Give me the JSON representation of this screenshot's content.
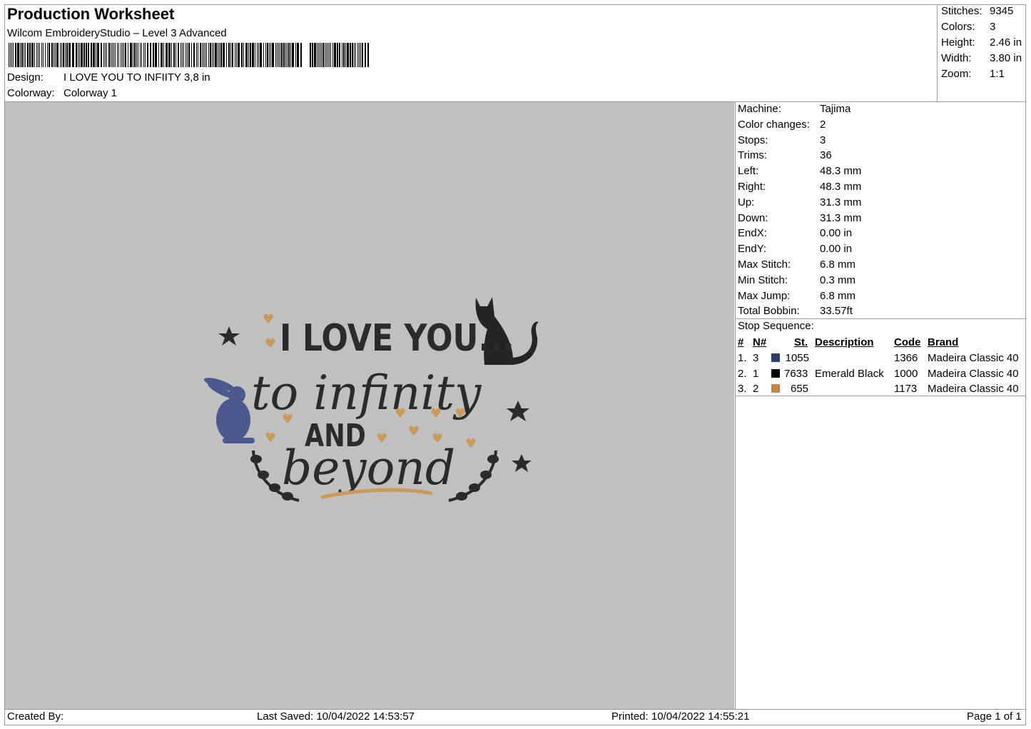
{
  "header": {
    "title": "Production Worksheet",
    "software": "Wilcom EmbroideryStudio – Level 3 Advanced",
    "design_label": "Design:",
    "design_value": "I LOVE YOU TO INFIITY 3,8 in",
    "colorway_label": "Colorway:",
    "colorway_value": "Colorway 1"
  },
  "summary": [
    {
      "label": "Stitches:",
      "value": "9345"
    },
    {
      "label": "Colors:",
      "value": "3"
    },
    {
      "label": "Height:",
      "value": "2.46 in"
    },
    {
      "label": "Width:",
      "value": "3.80 in"
    },
    {
      "label": "Zoom:",
      "value": "1:1"
    }
  ],
  "machine_info": [
    {
      "label": "Machine:",
      "value": "Tajima"
    },
    {
      "label": "Color changes:",
      "value": "2"
    },
    {
      "label": "Stops:",
      "value": "3"
    },
    {
      "label": "Trims:",
      "value": "36"
    },
    {
      "label": "Left:",
      "value": "48.3 mm"
    },
    {
      "label": "Right:",
      "value": "48.3 mm"
    },
    {
      "label": "Up:",
      "value": "31.3 mm"
    },
    {
      "label": "Down:",
      "value": "31.3 mm"
    },
    {
      "label": "EndX:",
      "value": "0.00 in"
    },
    {
      "label": "EndY:",
      "value": "0.00 in"
    },
    {
      "label": "Max Stitch:",
      "value": "6.8 mm"
    },
    {
      "label": "Min Stitch:",
      "value": "0.3 mm"
    },
    {
      "label": "Max Jump:",
      "value": "6.8 mm"
    },
    {
      "label": "Total Bobbin:",
      "value": "33.57ft"
    }
  ],
  "stop_sequence": {
    "title": "Stop Sequence:",
    "headers": {
      "num": "#",
      "needle": "N#",
      "st": "St.",
      "description": "Description",
      "code": "Code",
      "brand": "Brand"
    },
    "rows": [
      {
        "num": "1.",
        "needle": "3",
        "color": "#2e3d70",
        "st": "1055",
        "description": "",
        "code": "1366",
        "brand": "Madeira Classic 40"
      },
      {
        "num": "2.",
        "needle": "1",
        "color": "#000000",
        "st": "7633",
        "description": "Emerald Black",
        "code": "1000",
        "brand": "Madeira Classic 40"
      },
      {
        "num": "3.",
        "needle": "2",
        "color": "#c8834a",
        "st": "655",
        "description": "",
        "code": "1173",
        "brand": "Madeira Classic 40"
      }
    ]
  },
  "preview": {
    "background": "#c0c0c0",
    "text_lines": [
      "I LOVE YOU...",
      "to infinity",
      "AND",
      "beyond"
    ],
    "thread_colors": {
      "dark": "#2b2b2b",
      "blue": "#4b5a8e",
      "gold": "#c99a5b"
    }
  },
  "footer": {
    "created_by": "Created By:",
    "last_saved": "Last Saved: 10/04/2022 14:53:57",
    "printed": "Printed: 10/04/2022 14:55:21",
    "page": "Page 1 of 1"
  }
}
